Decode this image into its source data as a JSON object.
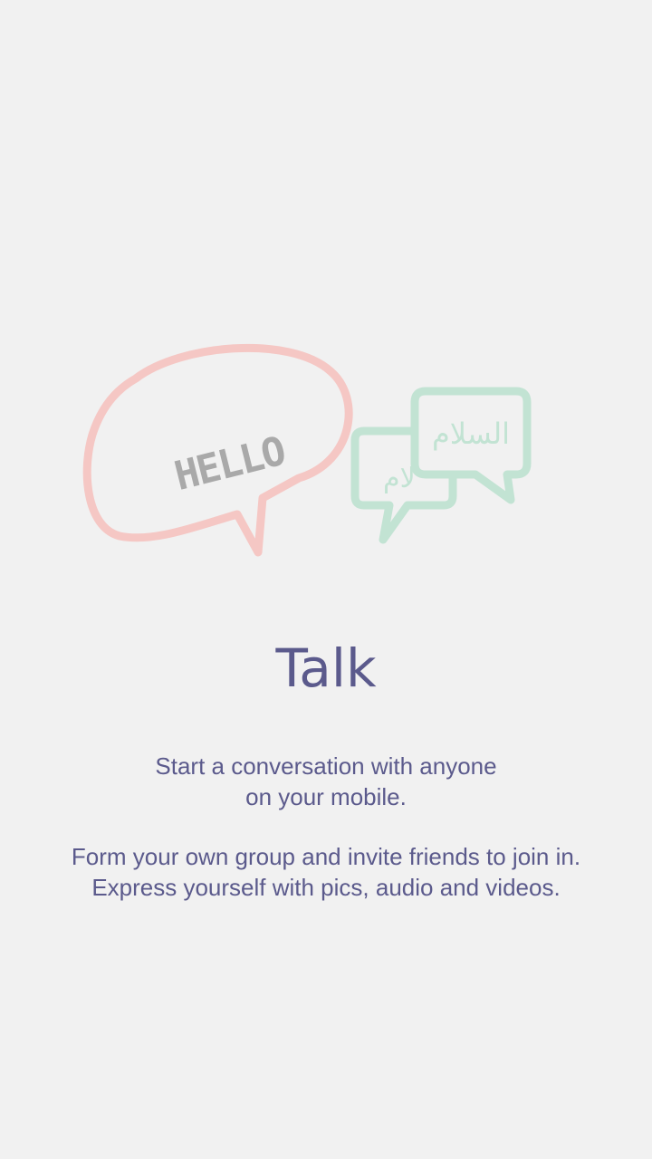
{
  "onboarding": {
    "illustration": {
      "hello_text": "HELLO",
      "salam_text": "السلام",
      "salam_partial_text": "لام",
      "colors": {
        "hello_bubble": "#f5c7c4",
        "hello_text": "#a9a9a9",
        "salam_bubbles": "#c2e3d3"
      }
    },
    "title": "Talk",
    "description": {
      "paragraph1": {
        "line1": "Start a conversation with anyone",
        "line2": "on your mobile."
      },
      "paragraph2": {
        "line1": "Form your own group and invite friends to join in.",
        "line2": "Express yourself with pics, audio and videos."
      }
    },
    "colors": {
      "background": "#f1f1f1",
      "text": "#5b5a8c"
    }
  }
}
